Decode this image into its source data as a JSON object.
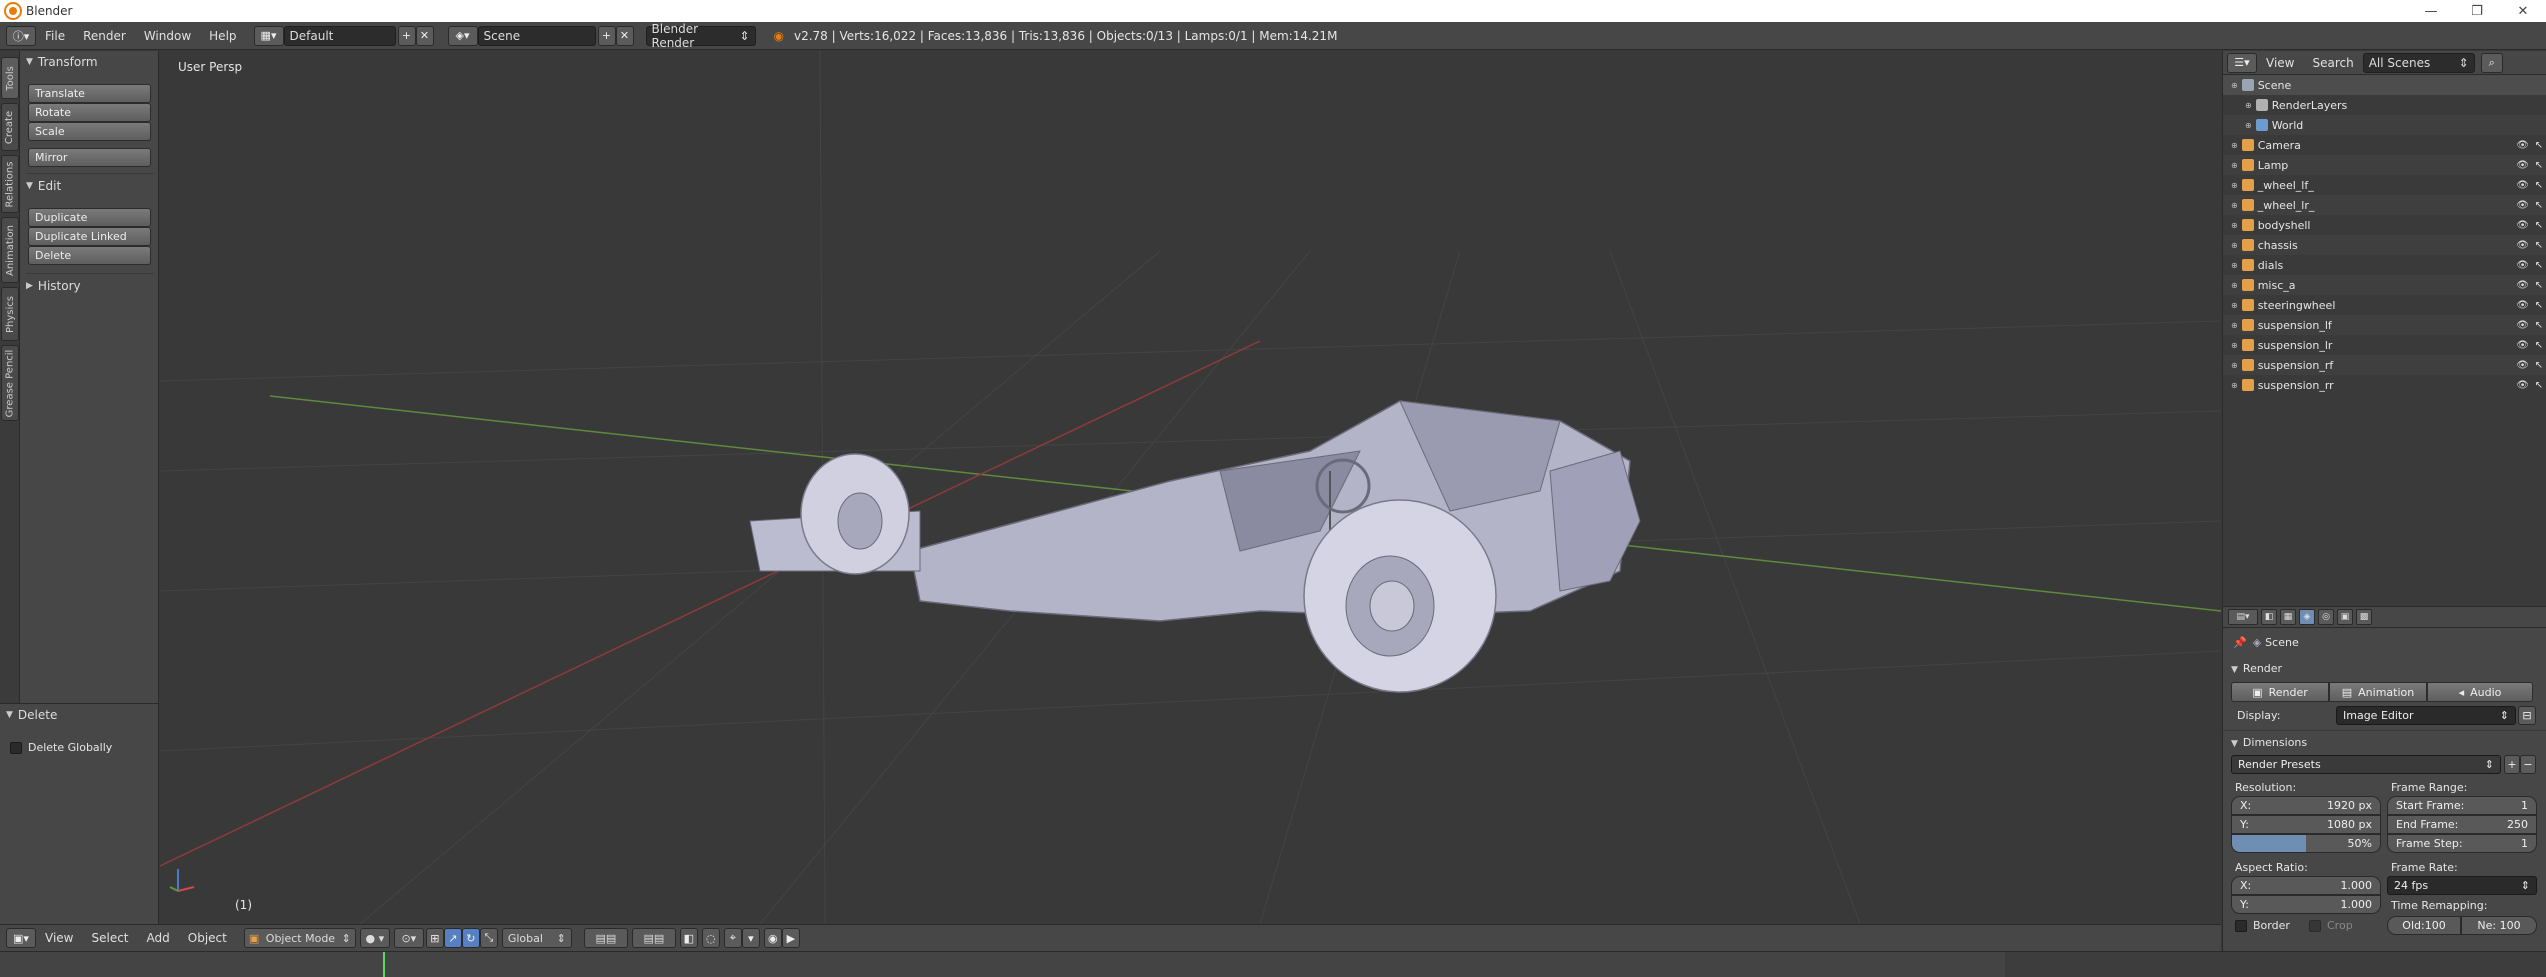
{
  "window": {
    "title": "Blender",
    "min": "—",
    "max": "❐",
    "close": "✕"
  },
  "infobar": {
    "menus": [
      "File",
      "Render",
      "Window",
      "Help"
    ],
    "screen_layout": "Default",
    "scene": "Scene",
    "engine": "Blender Render",
    "stats": "v2.78 | Verts:16,022 | Faces:13,836 | Tris:13,836 | Objects:0/13 | Lamps:0/1 | Mem:14.21M"
  },
  "tool_tabs": [
    "Tools",
    "Create",
    "Relations",
    "Animation",
    "Physics",
    "Grease Pencil"
  ],
  "toolshelf": {
    "transform_title": "Transform",
    "translate": "Translate",
    "rotate": "Rotate",
    "scale": "Scale",
    "mirror": "Mirror",
    "edit_title": "Edit",
    "duplicate": "Duplicate",
    "duplicate_linked": "Duplicate Linked",
    "delete": "Delete",
    "history_title": "History"
  },
  "operator": {
    "title": "Delete",
    "delete_globally": "Delete Globally"
  },
  "viewport": {
    "view_label": "User Persp",
    "frame_label": "(1)"
  },
  "view_header": {
    "menus": [
      "View",
      "Select",
      "Add",
      "Object"
    ],
    "mode": "Object Mode",
    "orientation": "Global"
  },
  "outliner": {
    "header_view": "View",
    "header_search": "Search",
    "display_filter": "All Scenes",
    "items": [
      {
        "label": "Scene",
        "color": "#9aa4b3"
      },
      {
        "label": "RenderLayers",
        "color": "#b0b0b0"
      },
      {
        "label": "World",
        "color": "#6b9bd1"
      },
      {
        "label": "Camera",
        "color": "#e4a049"
      },
      {
        "label": "Lamp",
        "color": "#e4a049"
      },
      {
        "label": "_wheel_lf_",
        "color": "#e4a049"
      },
      {
        "label": "_wheel_lr_",
        "color": "#e4a049"
      },
      {
        "label": "bodyshell",
        "color": "#e4a049"
      },
      {
        "label": "chassis",
        "color": "#e4a049"
      },
      {
        "label": "dials",
        "color": "#e4a049"
      },
      {
        "label": "misc_a",
        "color": "#e4a049"
      },
      {
        "label": "steeringwheel",
        "color": "#e4a049"
      },
      {
        "label": "suspension_lf",
        "color": "#e4a049"
      },
      {
        "label": "suspension_lr",
        "color": "#e4a049"
      },
      {
        "label": "suspension_rf",
        "color": "#e4a049"
      },
      {
        "label": "suspension_rr",
        "color": "#e4a049"
      }
    ]
  },
  "properties": {
    "context": "Scene",
    "render_title": "Render",
    "render_btn": "Render",
    "animation_btn": "Animation",
    "audio_btn": "Audio",
    "display_label": "Display:",
    "display_value": "Image Editor",
    "dimensions_title": "Dimensions",
    "render_presets": "Render Presets",
    "resolution_label": "Resolution:",
    "res_x_label": "X:",
    "res_x": "1920 px",
    "res_y_label": "Y:",
    "res_y": "1080 px",
    "res_pct": "50%",
    "frame_range_label": "Frame Range:",
    "start_label": "Start Frame:",
    "start": "1",
    "end_label": "End Frame:",
    "end": "250",
    "step_label": "Frame Step:",
    "step": "1",
    "aspect_label": "Aspect Ratio:",
    "asp_x_label": "X:",
    "asp_x": "1.000",
    "asp_y_label": "Y:",
    "asp_y": "1.000",
    "frame_rate_label": "Frame Rate:",
    "fps": "24 fps",
    "time_remap_label": "Time Remapping:",
    "border": "Border",
    "crop": "Crop",
    "old": "Old:100",
    "new": "Ne: 100"
  }
}
